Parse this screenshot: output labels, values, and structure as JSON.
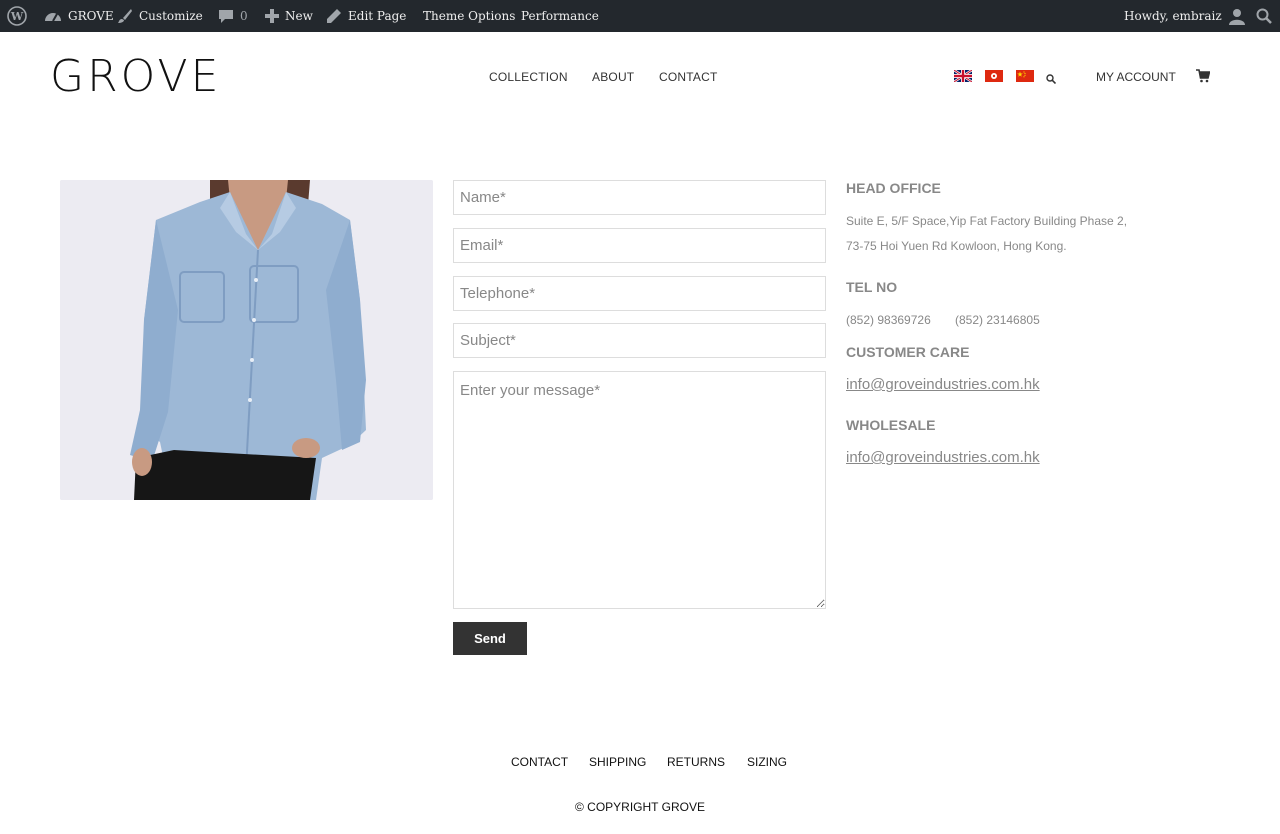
{
  "adminbar": {
    "wp_icon": "wordpress-logo-icon",
    "site_name": "GROVE",
    "customize": "Customize",
    "comments_count": "0",
    "new": "New",
    "edit_page": "Edit Page",
    "theme_options": "Theme Options",
    "performance": "Performance",
    "howdy": "Howdy, embraiz"
  },
  "header": {
    "logo": "GROVE",
    "nav": [
      "COLLECTION",
      "ABOUT",
      "CONTACT"
    ],
    "flags": [
      "uk-flag-icon",
      "hk-flag-icon",
      "cn-flag-icon"
    ],
    "my_account": "MY ACCOUNT"
  },
  "form": {
    "name_placeholder": "Name*",
    "email_placeholder": "Email*",
    "telephone_placeholder": "Telephone*",
    "subject_placeholder": "Subject*",
    "message_placeholder": "Enter your message*",
    "send_label": "Send"
  },
  "contact_info": {
    "head_office_title": "HEAD OFFICE",
    "address_line1": "Suite E, 5/F Space,Yip Fat Factory Building Phase 2,",
    "address_line2": "73-75 Hoi Yuen Rd Kowloon, Hong Kong.",
    "tel_title": "TEL NO",
    "tel1": "(852) 98369726",
    "tel2": "(852) 23146805",
    "customer_care_title": "CUSTOMER CARE",
    "customer_care_email": "info@groveindustries.com.hk",
    "wholesale_title": "WHOLESALE",
    "wholesale_email": "info@groveindustries.com.hk"
  },
  "footer": {
    "links": [
      "CONTACT",
      "SHIPPING",
      "RETURNS",
      "SIZING"
    ],
    "copyright": "© COPYRIGHT GROVE"
  }
}
